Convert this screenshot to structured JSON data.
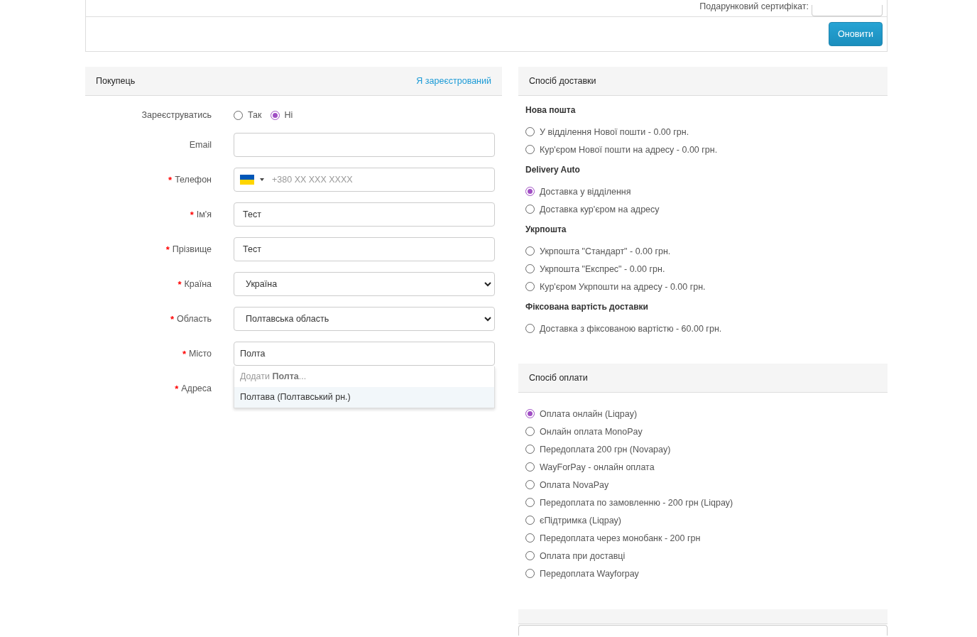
{
  "top_panel": {
    "gift_certificate_label": "Подарунковий сертифікат:",
    "update_button": "Оновити"
  },
  "customer": {
    "title": "Покупець",
    "login_link": "Я зареєстрований",
    "register": {
      "label": "Зареєструватись",
      "options": [
        {
          "label": "Так",
          "selected": false
        },
        {
          "label": "Ні",
          "selected": true
        }
      ]
    },
    "fields": [
      {
        "kind": "text",
        "label": "Email"
      },
      {
        "kind": "phone",
        "label": "Телефон",
        "required_mark": "*",
        "placeholder": "+380 XX XXX XXXX"
      },
      {
        "kind": "text",
        "label": "Ім'я",
        "required_mark": "*",
        "value": "Тест"
      },
      {
        "kind": "text",
        "label": "Прізвище",
        "required_mark": "*",
        "value": "Тест"
      },
      {
        "kind": "select",
        "label": "Країна",
        "required_mark": "*",
        "value": "Україна"
      },
      {
        "kind": "select",
        "label": "Область",
        "required_mark": "*",
        "value": "Полтавська область"
      },
      {
        "kind": "autocomplete",
        "label": "Місто",
        "required_mark": "*",
        "value": "Полта",
        "suggestions": [
          {
            "kind": "add",
            "text": "Додати **Полта**...",
            "selected": false
          },
          {
            "kind": "match",
            "text": "Полтава (Полтавський рн.)",
            "selected": true
          }
        ]
      },
      {
        "kind": "covered",
        "label": "Адреса",
        "required_mark": "*"
      }
    ]
  },
  "delivery": {
    "title": "Спосіб доставки",
    "groups": [
      {
        "title": "Нова пошта",
        "options": [
          {
            "label": "У відділення Нової пошти - 0.00 грн.",
            "selected": false
          },
          {
            "label": "Кур'єром Нової пошти на адресу - 0.00 грн.",
            "selected": false
          }
        ]
      },
      {
        "title": "Delivery Auto",
        "options": [
          {
            "label": "Доставка у відділення",
            "selected": true
          },
          {
            "label": "Доставка кур'єром на адресу",
            "selected": false
          }
        ]
      },
      {
        "title": "Укрпошта",
        "options": [
          {
            "label": "Укрпошта \"Стандарт\" - 0.00 грн.",
            "selected": false
          },
          {
            "label": "Укрпошта \"Експрес\" - 0.00 грн.",
            "selected": false
          },
          {
            "label": "Кур'єром Укрпошти на адресу - 0.00 грн.",
            "selected": false
          }
        ]
      },
      {
        "title": "Фіксована вартість доставки",
        "options": [
          {
            "label": "Доставка з фіксованою вартістю - 60.00 грн.",
            "selected": false
          }
        ]
      }
    ]
  },
  "payment": {
    "title": "Спосіб оплати",
    "options": [
      {
        "label": "Оплата онлайн (Liqpay)",
        "selected": true
      },
      {
        "label": "Онлайн оплата MonoPay",
        "selected": false
      },
      {
        "label": "Передоплата 200 грн (Novapay)",
        "selected": false
      },
      {
        "label": "WayForPay - онлайн оплата",
        "selected": false
      },
      {
        "label": "Оплата NovaPay",
        "selected": false
      },
      {
        "label": "Передоплата по замовленню - 200 грн (Liqpay)",
        "selected": false
      },
      {
        "label": "єПідтримка (Liqpay)",
        "selected": false
      },
      {
        "label": "Передоплата через монобанк - 200 грн",
        "selected": false
      },
      {
        "label": "Оплата при доставці",
        "selected": false
      },
      {
        "label": "Передоплата Wayforpay",
        "selected": false
      }
    ]
  }
}
